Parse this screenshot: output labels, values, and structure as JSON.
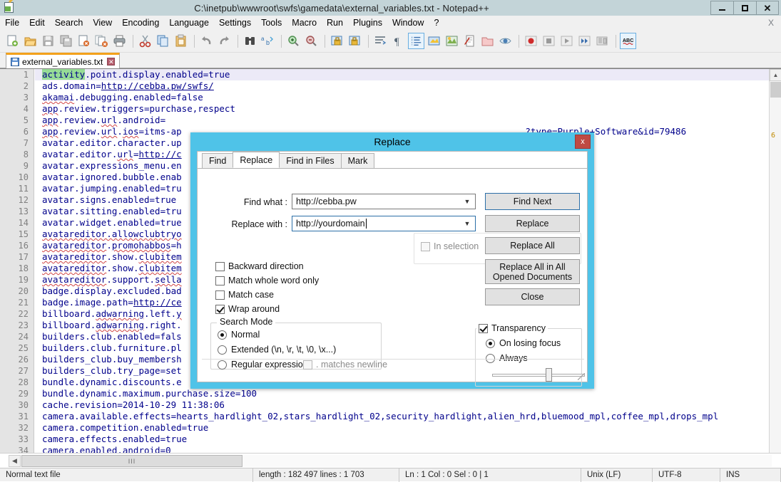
{
  "window": {
    "title": "C:\\inetpub\\wwwroot\\swfs\\gamedata\\external_variables.txt - Notepad++",
    "app_icon": "notepad-plus-plus-icon",
    "minimize_label": "",
    "maximize_label": "",
    "close_label": "✕"
  },
  "menu": {
    "items": [
      {
        "label": "File"
      },
      {
        "label": "Edit"
      },
      {
        "label": "Search"
      },
      {
        "label": "View"
      },
      {
        "label": "Encoding"
      },
      {
        "label": "Language"
      },
      {
        "label": "Settings"
      },
      {
        "label": "Tools"
      },
      {
        "label": "Macro"
      },
      {
        "label": "Run"
      },
      {
        "label": "Plugins"
      },
      {
        "label": "Window"
      },
      {
        "label": "?"
      }
    ],
    "document_close_label": "X"
  },
  "toolbar": {
    "buttons": [
      "new-file-icon",
      "open-file-icon",
      "save-icon",
      "save-all-icon",
      "close-file-icon",
      "close-all-files-icon",
      "print-icon",
      "cut-icon",
      "copy-icon",
      "paste-icon",
      "undo-icon",
      "redo-icon",
      "find-icon",
      "replace-icon",
      "zoom-in-icon",
      "zoom-out-icon",
      "sync-vertical-scroll-icon",
      "sync-horizontal-scroll-icon",
      "word-wrap-icon",
      "show-all-characters-icon",
      "indent-guideline-icon",
      "user-defined-language-icon",
      "show-document-map-icon",
      "function-list-icon",
      "folder-as-workspace-icon",
      "monitoring-icon",
      "record-macro-icon",
      "stop-recording-icon",
      "playback-macro-icon",
      "run-macro-multiple-icon",
      "save-macro-icon",
      "spell-check-icon"
    ]
  },
  "tab": {
    "label": "external_variables.txt",
    "close_label": "✕",
    "icon": "saved-document-icon"
  },
  "editor": {
    "lines": [
      {
        "n": "1",
        "current": true,
        "parts": [
          {
            "t": "activity",
            "hl": true
          },
          {
            "t": ".point.display.enabled=true"
          }
        ]
      },
      {
        "n": "2",
        "parts": [
          {
            "t": "ads.domain="
          },
          {
            "t": "http://cebba.pw/swfs/",
            "link": true
          }
        ]
      },
      {
        "n": "3",
        "parts": [
          {
            "t": "akamai",
            "sq": true
          },
          {
            "t": ".debugging.enabled=false"
          }
        ]
      },
      {
        "n": "4",
        "parts": [
          {
            "t": "app",
            "sq": true
          },
          {
            "t": ".review.triggers=purchase,respect"
          }
        ]
      },
      {
        "n": "5",
        "parts": [
          {
            "t": "app",
            "sq": true
          },
          {
            "t": ".review."
          },
          {
            "t": "url",
            "sq": true
          },
          {
            "t": ".android="
          }
        ]
      },
      {
        "n": "6",
        "parts": [
          {
            "t": "app",
            "sq": true
          },
          {
            "t": ".review."
          },
          {
            "t": "url",
            "sq": true
          },
          {
            "t": "."
          },
          {
            "t": "ios",
            "sq": true
          },
          {
            "t": "=itms-ap"
          },
          {
            "t": "████████████████████████████████████████████████████████████████",
            "occluded": true
          },
          {
            "t": "?type=Purple+Software&id=79486"
          }
        ]
      },
      {
        "n": "7",
        "parts": [
          {
            "t": "avatar.editor.character.up"
          }
        ]
      },
      {
        "n": "8",
        "parts": [
          {
            "t": "avatar.editor."
          },
          {
            "t": "url",
            "sq": true
          },
          {
            "t": "="
          },
          {
            "t": "http://c",
            "link": true
          }
        ]
      },
      {
        "n": "9",
        "parts": [
          {
            "t": "avatar.expressions_menu.en"
          }
        ]
      },
      {
        "n": "10",
        "parts": [
          {
            "t": "avatar.ignored.bubble.enab"
          }
        ]
      },
      {
        "n": "11",
        "parts": [
          {
            "t": "avatar.jumping.enabled=tru"
          }
        ]
      },
      {
        "n": "12",
        "parts": [
          {
            "t": "avatar.signs.enabled=true"
          }
        ]
      },
      {
        "n": "13",
        "parts": [
          {
            "t": "avatar.sitting.enabled=tru"
          }
        ]
      },
      {
        "n": "14",
        "parts": [
          {
            "t": "avatar.widget.enabled=true"
          }
        ]
      },
      {
        "n": "15",
        "parts": [
          {
            "t": "avatareditor.allowclubtryo",
            "sq": true
          }
        ]
      },
      {
        "n": "16",
        "parts": [
          {
            "t": "avatareditor",
            "sq": true
          },
          {
            "t": "."
          },
          {
            "t": "promohabbos",
            "sq": true
          },
          {
            "t": "=h"
          }
        ]
      },
      {
        "n": "17",
        "parts": [
          {
            "t": "avatareditor",
            "sq": true
          },
          {
            "t": ".show."
          },
          {
            "t": "clubitem",
            "sq": true
          }
        ]
      },
      {
        "n": "18",
        "parts": [
          {
            "t": "avatareditor",
            "sq": true
          },
          {
            "t": ".show."
          },
          {
            "t": "clubitem",
            "sq": true
          }
        ]
      },
      {
        "n": "19",
        "parts": [
          {
            "t": "avatareditor",
            "sq": true
          },
          {
            "t": ".support."
          },
          {
            "t": "sella",
            "sq": true
          }
        ]
      },
      {
        "n": "20",
        "parts": [
          {
            "t": "badge.display.excluded.bad"
          }
        ]
      },
      {
        "n": "21",
        "parts": [
          {
            "t": "badge.image.path="
          },
          {
            "t": "http://ce",
            "link": true
          }
        ]
      },
      {
        "n": "22",
        "parts": [
          {
            "t": "billboard."
          },
          {
            "t": "adwarning",
            "sq": true
          },
          {
            "t": ".left."
          },
          {
            "t": "y",
            "sq": true
          }
        ]
      },
      {
        "n": "23",
        "parts": [
          {
            "t": "billboard."
          },
          {
            "t": "adwarning",
            "sq": true
          },
          {
            "t": ".right."
          }
        ]
      },
      {
        "n": "24",
        "parts": [
          {
            "t": "builders.club.enabled=fals"
          }
        ]
      },
      {
        "n": "25",
        "parts": [
          {
            "t": "builders.club.furniture.pl"
          }
        ]
      },
      {
        "n": "26",
        "parts": [
          {
            "t": "builders_club.buy_membersh"
          }
        ]
      },
      {
        "n": "27",
        "parts": [
          {
            "t": "builders_club.try_page=set"
          }
        ]
      },
      {
        "n": "28",
        "parts": [
          {
            "t": "bundle.dynamic.discounts.e"
          }
        ]
      },
      {
        "n": "29",
        "parts": [
          {
            "t": "bundle.dynamic.maximum.purchase.size=100"
          }
        ]
      },
      {
        "n": "30",
        "parts": [
          {
            "t": "cache.revision=2014-10-29 11:38:06"
          }
        ]
      },
      {
        "n": "31",
        "parts": [
          {
            "t": "camera.available.effects=hearts_hardlight_02,stars_hardlight_02,security_hardlight,alien_hrd,bluemood_mpl,coffee_mpl,drops_mpl"
          }
        ]
      },
      {
        "n": "32",
        "parts": [
          {
            "t": "camera.competition.enabled=true"
          }
        ]
      },
      {
        "n": "33",
        "parts": [
          {
            "t": "camera.effects.enabled=true"
          }
        ]
      },
      {
        "n": "34",
        "parts": [
          {
            "t": "camera.enabled.android=0"
          }
        ]
      }
    ],
    "vscroll_marker": "6"
  },
  "statusbar": {
    "doc_type": "Normal text file",
    "length_lines": "length : 182 497    lines : 1 703",
    "position": "Ln : 1    Col : 0    Sel : 0 | 1",
    "eol": "Unix (LF)",
    "encoding": "UTF-8",
    "insert_mode": "INS"
  },
  "replace_dialog": {
    "title": "Replace",
    "close_label": "x",
    "tabs": [
      {
        "label": "Find",
        "active": false
      },
      {
        "label": "Replace",
        "active": true
      },
      {
        "label": "Find in Files",
        "active": false
      },
      {
        "label": "Mark",
        "active": false
      }
    ],
    "find_what_label": "Find what :",
    "find_what_value": "http://cebba.pw",
    "replace_with_label": "Replace with :",
    "replace_with_value": "http://yourdomain",
    "buttons": {
      "find_next": "Find Next",
      "replace": "Replace",
      "replace_all": "Replace All",
      "replace_all_opened": "Replace All in All Opened Documents",
      "close": "Close"
    },
    "in_selection": {
      "label": "In selection",
      "checked": false,
      "disabled": true
    },
    "options": [
      {
        "label": "Backward direction",
        "checked": false
      },
      {
        "label": "Match whole word only",
        "checked": false
      },
      {
        "label": "Match case",
        "checked": false
      },
      {
        "label": "Wrap around",
        "checked": true
      }
    ],
    "search_mode": {
      "title": "Search Mode",
      "options": [
        {
          "label": "Normal",
          "selected": true
        },
        {
          "label": "Extended (\\n, \\r, \\t, \\0, \\x...)",
          "selected": false
        },
        {
          "label": "Regular expression",
          "selected": false
        }
      ],
      "dot_matches_newline": {
        "label": ". matches newline",
        "checked": false,
        "disabled": true
      }
    },
    "transparency": {
      "label": "Transparency",
      "checked": true,
      "options": [
        {
          "label": "On losing focus",
          "selected": true
        },
        {
          "label": "Always",
          "selected": false
        }
      ],
      "slider_value": 58
    },
    "status_message": ""
  },
  "colors": {
    "dialog_border": "#4fc3e8",
    "titlebar": "#c3d4d8",
    "tab_active_top": "#f3a11b",
    "highlight_match": "#96dc96",
    "current_line": "#eceaf7",
    "code_text": "#00008b",
    "dialog_close": "#bf4a43"
  }
}
